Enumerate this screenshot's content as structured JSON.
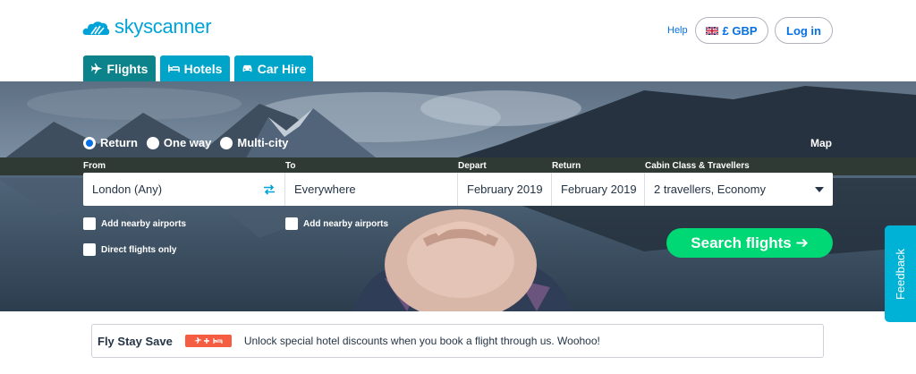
{
  "header": {
    "logo_text": "skyscanner",
    "help_label": "Help",
    "currency_label": "£ GBP",
    "login_label": "Log in"
  },
  "tabs": [
    {
      "label": "Flights",
      "icon": "plane-icon",
      "active": true
    },
    {
      "label": "Hotels",
      "icon": "bed-icon",
      "active": false
    },
    {
      "label": "Car Hire",
      "icon": "car-icon",
      "active": false
    }
  ],
  "search": {
    "trip_types": [
      {
        "label": "Return",
        "checked": true
      },
      {
        "label": "One way",
        "checked": false
      },
      {
        "label": "Multi-city",
        "checked": false
      }
    ],
    "map_label": "Map",
    "labels": {
      "from": "From",
      "to": "To",
      "depart": "Depart",
      "return": "Return",
      "cabin": "Cabin Class & Travellers"
    },
    "values": {
      "from": "London (Any)",
      "to": "Everywhere",
      "depart": "February 2019",
      "return": "February 2019",
      "cabin": "2 travellers, Economy"
    },
    "add_nearby_from": "Add nearby airports",
    "add_nearby_to": "Add nearby airports",
    "direct_only": "Direct flights only",
    "search_button": "Search flights ➔"
  },
  "feedback_label": "Feedback",
  "banner": {
    "title": "Fly Stay Save",
    "text": "Unlock special hotel discounts when you book a flight through us. Woohoo!"
  },
  "colors": {
    "brand": "#00a3d7",
    "tab_active": "#0c838a",
    "tab": "#00a4c9",
    "search_button": "#00d775",
    "badge": "#f55d42"
  }
}
